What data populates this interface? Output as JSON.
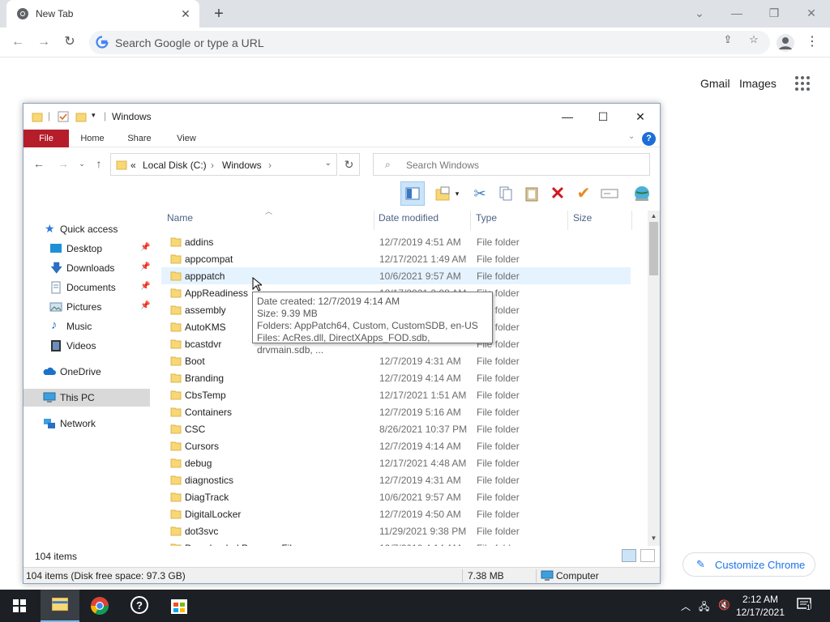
{
  "browser": {
    "tab_title": "New Tab",
    "new_tab_symbol": "+",
    "omnibox_placeholder": "Search Google or type a URL",
    "links": {
      "gmail": "Gmail",
      "images": "Images"
    },
    "customize_label": "Customize Chrome"
  },
  "explorer": {
    "window_title": "Windows",
    "ribbon_tabs": [
      "File",
      "Home",
      "Share",
      "View"
    ],
    "address": {
      "root_label": "Local Disk (C:)",
      "folder_label": "Windows",
      "overflow": "«"
    },
    "search_placeholder": "Search Windows",
    "nav_items": [
      {
        "label": "Quick access",
        "icon": "star-icon"
      },
      {
        "label": "Desktop",
        "icon": "desktop-icon",
        "pinned": true
      },
      {
        "label": "Downloads",
        "icon": "download-icon",
        "pinned": true
      },
      {
        "label": "Documents",
        "icon": "documents-icon",
        "pinned": true
      },
      {
        "label": "Pictures",
        "icon": "pictures-icon",
        "pinned": true
      },
      {
        "label": "Music",
        "icon": "music-icon"
      },
      {
        "label": "Videos",
        "icon": "videos-icon"
      },
      {
        "label": "OneDrive",
        "icon": "cloud-icon"
      },
      {
        "label": "This PC",
        "icon": "computer-icon",
        "selected": true
      },
      {
        "label": "Network",
        "icon": "network-icon"
      }
    ],
    "columns": {
      "name": "Name",
      "date": "Date modified",
      "type": "Type",
      "size": "Size"
    },
    "files": [
      {
        "name": "addins",
        "date": "12/7/2019 4:51 AM",
        "type": "File folder"
      },
      {
        "name": "appcompat",
        "date": "12/17/2021 1:49 AM",
        "type": "File folder"
      },
      {
        "name": "apppatch",
        "date": "10/6/2021 9:57 AM",
        "type": "File folder",
        "hover": true
      },
      {
        "name": "AppReadiness",
        "date": "12/17/2021 2:08 AM",
        "type": "File folder"
      },
      {
        "name": "assembly",
        "date": "",
        "type": "File folder"
      },
      {
        "name": "AutoKMS",
        "date": "",
        "type": "File folder"
      },
      {
        "name": "bcastdvr",
        "date": "",
        "type": "File folder"
      },
      {
        "name": "Boot",
        "date": "12/7/2019 4:31 AM",
        "type": "File folder"
      },
      {
        "name": "Branding",
        "date": "12/7/2019 4:14 AM",
        "type": "File folder"
      },
      {
        "name": "CbsTemp",
        "date": "12/17/2021 1:51 AM",
        "type": "File folder"
      },
      {
        "name": "Containers",
        "date": "12/7/2019 5:16 AM",
        "type": "File folder"
      },
      {
        "name": "CSC",
        "date": "8/26/2021 10:37 PM",
        "type": "File folder"
      },
      {
        "name": "Cursors",
        "date": "12/7/2019 4:14 AM",
        "type": "File folder"
      },
      {
        "name": "debug",
        "date": "12/17/2021 4:48 AM",
        "type": "File folder"
      },
      {
        "name": "diagnostics",
        "date": "12/7/2019 4:31 AM",
        "type": "File folder"
      },
      {
        "name": "DiagTrack",
        "date": "10/6/2021 9:57 AM",
        "type": "File folder"
      },
      {
        "name": "DigitalLocker",
        "date": "12/7/2019 4:50 AM",
        "type": "File folder"
      },
      {
        "name": "dot3svc",
        "date": "11/29/2021 9:38 PM",
        "type": "File folder"
      },
      {
        "name": "Downloaded Program Files",
        "date": "12/7/2019 4:14 AM",
        "type": "File folder"
      }
    ],
    "tooltip": {
      "line1": "Date created: 12/7/2019 4:14 AM",
      "line2": "Size: 9.39 MB",
      "line3": "Folders: AppPatch64, Custom, CustomSDB, en-US",
      "line4": "Files: AcRes.dll, DirectXApps_FOD.sdb, drvmain.sdb, ..."
    },
    "status_count": "104 items",
    "details_bar": {
      "summary": "104 items (Disk free space: 97.3 GB)",
      "size": "7.38 MB",
      "location": "Computer"
    }
  },
  "taskbar": {
    "time": "2:12 AM",
    "date": "12/17/2021",
    "notification_count": "1"
  },
  "colors": {
    "file_tab": "#b51d2b",
    "hover_row": "#e5f3ff",
    "link_blue": "#1a73e8",
    "taskbar": "#1c2025"
  }
}
